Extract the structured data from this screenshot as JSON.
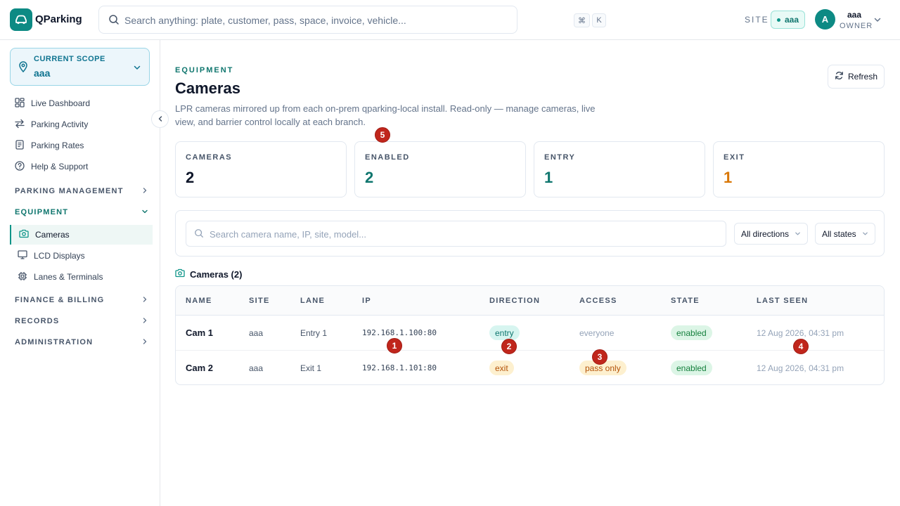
{
  "brand": {
    "name": "QParking"
  },
  "search": {
    "placeholder": "Search anything: plate, customer, pass, space, invoice, vehicle...",
    "kbd1": "⌘",
    "kbd2": "K"
  },
  "site": {
    "label": "SITE",
    "value": "aaa"
  },
  "user": {
    "initial": "A",
    "name": "aaa",
    "role": "OWNER"
  },
  "scope": {
    "label": "CURRENT SCOPE",
    "value": "aaa"
  },
  "nav": {
    "items": [
      {
        "label": "Live Dashboard"
      },
      {
        "label": "Parking Activity"
      },
      {
        "label": "Parking Rates"
      },
      {
        "label": "Help & Support"
      }
    ],
    "sections": {
      "parking_management": "PARKING MANAGEMENT",
      "equipment": "EQUIPMENT",
      "finance": "FINANCE & BILLING",
      "records": "RECORDS",
      "administration": "ADMINISTRATION"
    },
    "equipment_items": [
      {
        "label": "Cameras"
      },
      {
        "label": "LCD Displays"
      },
      {
        "label": "Lanes & Terminals"
      }
    ]
  },
  "page": {
    "eyebrow": "EQUIPMENT",
    "title": "Cameras",
    "description": "LPR cameras mirrored up from each on-prem qparking-local install. Read-only — manage cameras, live view, and barrier control locally at each branch.",
    "refresh_label": "Refresh"
  },
  "stats": [
    {
      "label": "CAMERAS",
      "value": "2",
      "color": "#0f172a"
    },
    {
      "label": "ENABLED",
      "value": "2",
      "color": "#0f766e"
    },
    {
      "label": "ENTRY",
      "value": "1",
      "color": "#0f766e"
    },
    {
      "label": "EXIT",
      "value": "1",
      "color": "#d97706"
    }
  ],
  "filters": {
    "search_placeholder": "Search camera name, IP, site, model...",
    "direction": "All directions",
    "state": "All states"
  },
  "table": {
    "title": "Cameras (2)",
    "columns": [
      "NAME",
      "SITE",
      "LANE",
      "IP",
      "DIRECTION",
      "ACCESS",
      "STATE",
      "LAST SEEN"
    ],
    "rows": [
      {
        "name": "Cam 1",
        "site": "aaa",
        "lane": "Entry 1",
        "ip": "192.168.1.100:80",
        "direction": "entry",
        "access": "everyone",
        "state": "enabled",
        "last_seen": "12 Aug 2026, 04:31 pm"
      },
      {
        "name": "Cam 2",
        "site": "aaa",
        "lane": "Exit 1",
        "ip": "192.168.1.101:80",
        "direction": "exit",
        "access": "pass only",
        "state": "enabled",
        "last_seen": "12 Aug 2026, 04:31 pm"
      }
    ]
  },
  "markers": [
    "1",
    "2",
    "3",
    "4",
    "5"
  ]
}
